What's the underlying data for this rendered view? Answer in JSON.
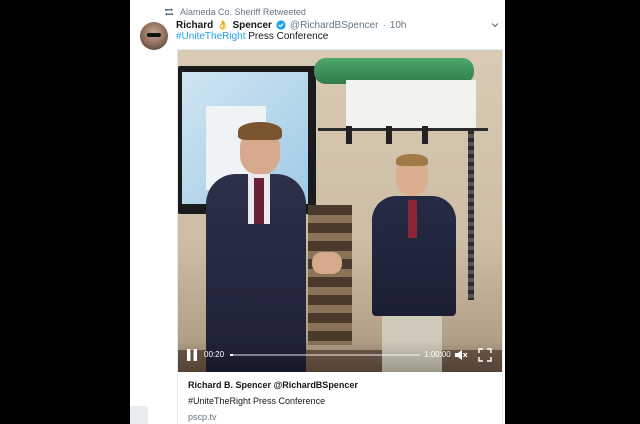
{
  "retweet": {
    "text": "Alameda Co. Sheriff Retweeted",
    "icon": "retweet-icon"
  },
  "author": {
    "name_first": "Richard",
    "name_emoji": "👌",
    "name_last": "Spencer",
    "handle": "@RichardBSpencer",
    "separator": "·",
    "time": "10h",
    "verified": true
  },
  "tweet": {
    "hashtag": "#UniteTheRight",
    "text": " Press Conference"
  },
  "video": {
    "current_time": "00:20",
    "duration": "1:00:00",
    "progress": 0.0056
  },
  "card": {
    "title": "Richard B. Spencer @RichardBSpencer",
    "description": "#UniteTheRight Press Conference",
    "domain": "pscp.tv"
  },
  "colors": {
    "link": "#1da1f2",
    "verified": "#1da1f2",
    "muted_text": "#657786",
    "background": "#000000"
  }
}
